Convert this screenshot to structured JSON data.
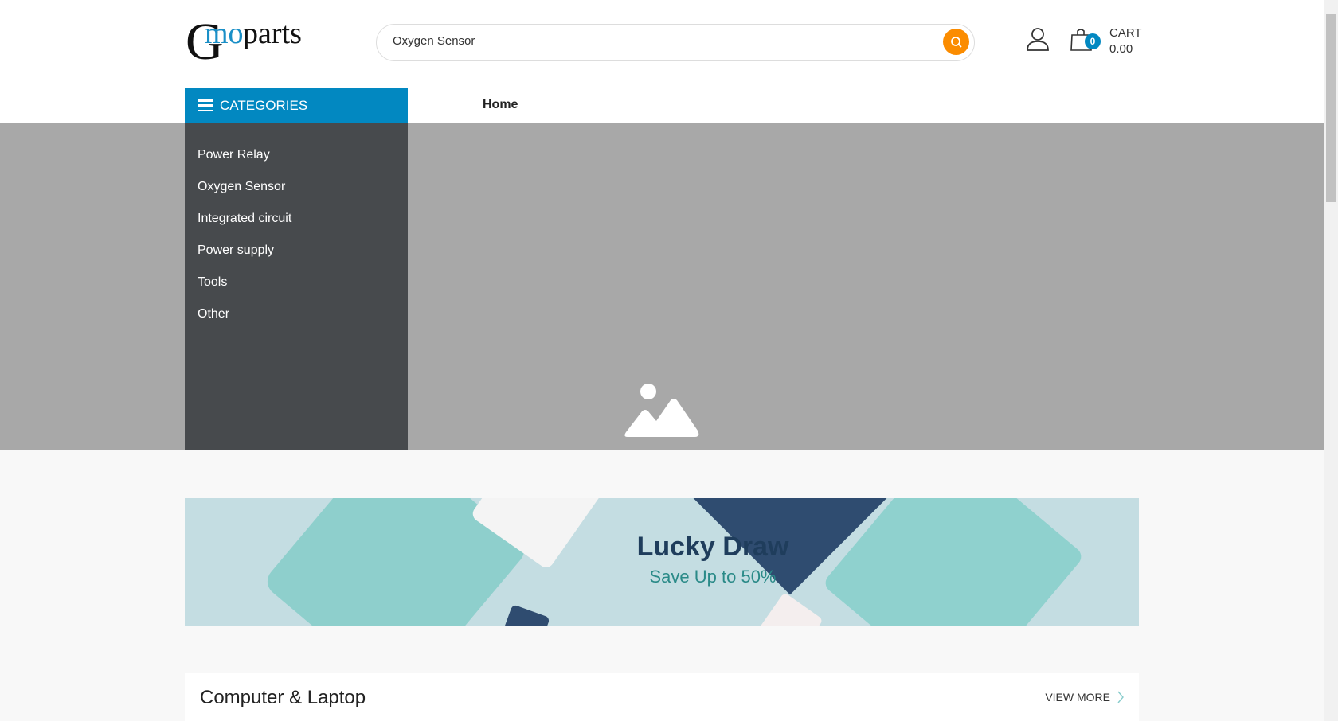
{
  "header": {
    "logo_text": "Gmoparts",
    "search": {
      "value": "Oxygen Sensor",
      "placeholder": ""
    },
    "cart": {
      "label": "CART",
      "total": "0.00",
      "count": "0"
    }
  },
  "nav": {
    "categories_label": "CATEGORIES",
    "links": [
      {
        "label": "Home"
      }
    ]
  },
  "sidebar": {
    "items": [
      {
        "label": "Power Relay"
      },
      {
        "label": "Oxygen Sensor"
      },
      {
        "label": "Integrated circuit"
      },
      {
        "label": "Power supply"
      },
      {
        "label": "Tools"
      },
      {
        "label": "Other"
      }
    ]
  },
  "banner": {
    "title": "Lucky Draw",
    "subtitle": "Save Up to 50%"
  },
  "section": {
    "title": "Computer & Laptop",
    "view_more": "VIEW MORE"
  },
  "colors": {
    "accent": "#0288c1",
    "search_button": "#fb8c00",
    "sidebar_bg": "#474a4d",
    "hero_bg": "#a8a8a8"
  }
}
